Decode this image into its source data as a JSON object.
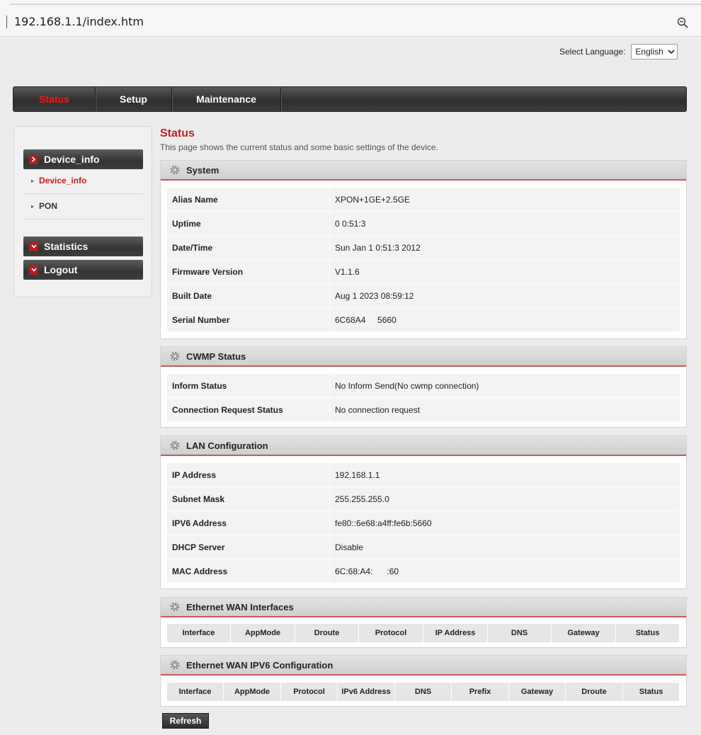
{
  "browser": {
    "url": "192.168.1.1/index.htm"
  },
  "language": {
    "label": "Select Language:",
    "selected": "English"
  },
  "topnav": {
    "items": [
      "Status",
      "Setup",
      "Maintenance"
    ],
    "active": "Status"
  },
  "sidebar": {
    "device_info": "Device_info",
    "sub_device_info": "Device_info",
    "sub_pon": "PON",
    "statistics": "Statistics",
    "logout": "Logout"
  },
  "page": {
    "title": "Status",
    "description": "This page shows the current status and some basic settings of the device."
  },
  "system": {
    "title": "System",
    "rows": [
      {
        "key": "Alias Name",
        "value": "XPON+1GE+2.5GE"
      },
      {
        "key": "Uptime",
        "value": "0 0:51:3"
      },
      {
        "key": "Date/Time",
        "value": "Sun Jan 1 0:51:3 2012"
      },
      {
        "key": "Firmware Version",
        "value": "V1.1.6"
      },
      {
        "key": "Built Date",
        "value": "Aug 1 2023 08:59:12"
      },
      {
        "key": "Serial Number",
        "value": "6C68A4     5660"
      }
    ]
  },
  "cwmp": {
    "title": "CWMP Status",
    "rows": [
      {
        "key": "Inform Status",
        "value": "No Inform Send(No cwmp connection)"
      },
      {
        "key": "Connection Request Status",
        "value": "No connection request"
      }
    ]
  },
  "lan": {
    "title": "LAN Configuration",
    "rows": [
      {
        "key": "IP Address",
        "value": "192.168.1.1"
      },
      {
        "key": "Subnet Mask",
        "value": "255.255.255.0"
      },
      {
        "key": "IPV6 Address",
        "value": "fe80::6e68:a4ff:fe6b:5660"
      },
      {
        "key": "DHCP Server",
        "value": "Disable"
      },
      {
        "key": "MAC Address",
        "value": "6C:68:A4:      :60"
      }
    ]
  },
  "wan": {
    "title": "Ethernet WAN Interfaces",
    "columns": [
      "Interface",
      "AppMode",
      "Droute",
      "Protocol",
      "IP Address",
      "DNS",
      "Gateway",
      "Status"
    ]
  },
  "wan6": {
    "title": "Ethernet WAN IPV6 Configuration",
    "columns": [
      "Interface",
      "AppMode",
      "Protocol",
      "IPv6 Address",
      "DNS",
      "Prefix",
      "Gateway",
      "Droute",
      "Status"
    ]
  },
  "refresh_label": "Refresh"
}
